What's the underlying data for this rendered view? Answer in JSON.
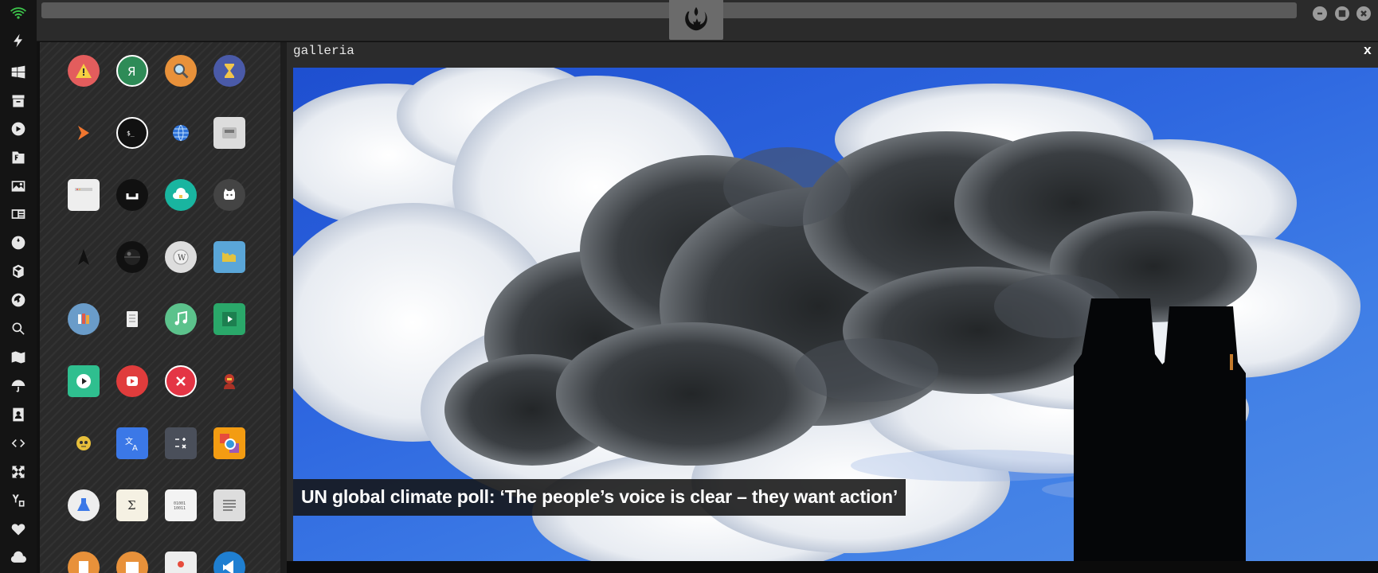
{
  "dock": {
    "items": [
      "wifi-icon",
      "lightning-icon",
      "windows-icon",
      "archive-icon",
      "play-icon",
      "translate-book-icon",
      "image-icon",
      "news-icon",
      "rebel-icon",
      "wolfram-icon",
      "globe-icon",
      "search-icon",
      "map-icon",
      "umbrella-icon",
      "contacts-icon",
      "code-icon",
      "fullscreen-icon",
      "youtube-icon",
      "heart-icon",
      "cloud-icon"
    ]
  },
  "topbar": {
    "center_icon": "rebel-alliance-icon",
    "window_controls": [
      "minimize-icon",
      "maximize-icon",
      "close-icon"
    ]
  },
  "apps": [
    [
      "warning-app",
      "yandex-app",
      "search-app",
      "hourglass-app"
    ],
    [
      "sublime-app",
      "terminal-app",
      "globe-app",
      "drive-app"
    ],
    [
      "window-app",
      "bracket-app",
      "cloud-lock-app",
      "github-app"
    ],
    [
      "starfleet-app",
      "death-star-app",
      "wikipedia-app",
      "world-map-app"
    ],
    [
      "library-app",
      "notes-app",
      "music-app",
      "video-app"
    ],
    [
      "player-app",
      "youtube-app",
      "close-app",
      "ironman-app"
    ],
    [
      "c3po-app",
      "translate-app",
      "calculator-app",
      "camera-app"
    ],
    [
      "lab-app",
      "sigma-app",
      "binary-app",
      "text-editor-app"
    ],
    [
      "document-app",
      "image-viewer-app",
      "presentation-app",
      "vscode-app"
    ]
  ],
  "gallery": {
    "title": "galleria",
    "close_label": "x",
    "caption": "UN global climate poll: ‘The people’s voice is clear – they want action’"
  },
  "colors": {
    "sky": "#2e67e0",
    "panel": "#2a2a2a",
    "dock": "#141414"
  }
}
